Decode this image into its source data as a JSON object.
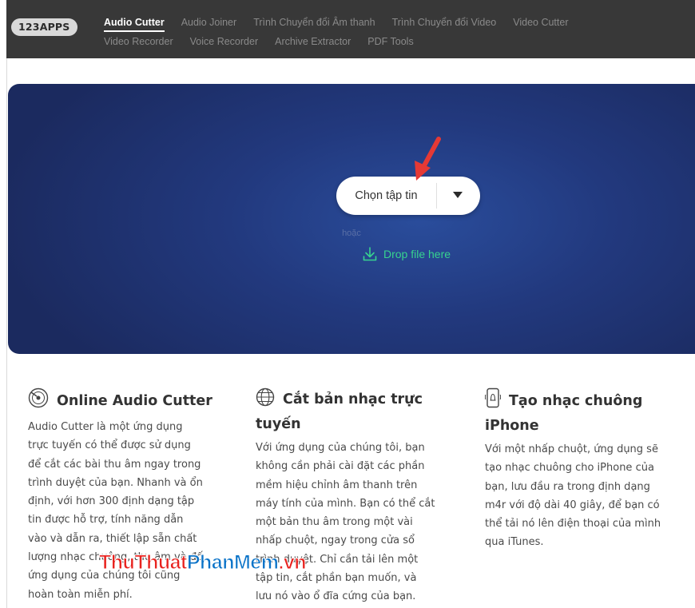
{
  "nav": {
    "logo": "123APPS",
    "row1": [
      "Audio Cutter",
      "Audio Joiner",
      "Trình Chuyển đổi Âm thanh",
      "Trình Chuyển đổi Video",
      "Video Cutter"
    ],
    "row2": [
      "Video Recorder",
      "Voice Recorder",
      "Archive Extractor",
      "PDF Tools"
    ],
    "active": "Audio Cutter"
  },
  "hero": {
    "choose_file_label": "Chọn tập tin",
    "or_text": "hoặc",
    "drop_label": "Drop file here"
  },
  "features": [
    {
      "icon": "vinyl-disc-icon",
      "title": "Online Audio Cutter",
      "body": [
        "Audio Cutter là một ứng dụng",
        "trực tuyến có thể được sử dụng",
        "để cắt các bài thu âm ngay trong",
        "trình duyệt của bạn. Nhanh và ổn",
        "định, với hơn 300 định dạng tập",
        "tin được hỗ trợ, tính năng dẫn",
        "vào và dẫn ra, thiết lập sẵn chất",
        "lượng nhạc chuông, thu âm và đố",
        "ứng dụng của chúng tôi cũng",
        "hoàn toàn miễn phí."
      ]
    },
    {
      "icon": "globe-icon",
      "title": "Cắt bản nhạc trực tuyến",
      "body": [
        "Với ứng dụng của chúng tôi, bạn",
        "không cần phải cài đặt các phần",
        "mềm hiệu chỉnh âm thanh trên",
        "máy tính của mình. Bạn có thể cắt",
        "một bản thu âm trong một vài",
        "nhấp chuột, ngay trong cửa sổ",
        "trình duyệt. Chỉ cần tải lên một",
        "tập tin, cắt phần bạn muốn, và",
        "lưu nó vào ổ đĩa cứng của bạn."
      ]
    },
    {
      "icon": "phone-bell-icon",
      "title": "Tạo nhạc chuông iPhone",
      "body": [
        "Với một nhấp chuột, ứng dụng sẽ",
        "tạo nhạc chuông cho iPhone của",
        "bạn, lưu đầu ra trong định dạng",
        "m4r với độ dài 40 giây, để bạn có",
        "thể tải nó lên điện thoại của mình",
        "qua iTunes."
      ]
    }
  ],
  "watermark": {
    "part1": "ThuThuat",
    "part2": "PhanMem",
    "part3": ".vn"
  },
  "colors": {
    "nav_bg": "#383838",
    "hero_bg": "#22397e",
    "drop_accent": "#37d38f",
    "arrow": "#e53935"
  }
}
